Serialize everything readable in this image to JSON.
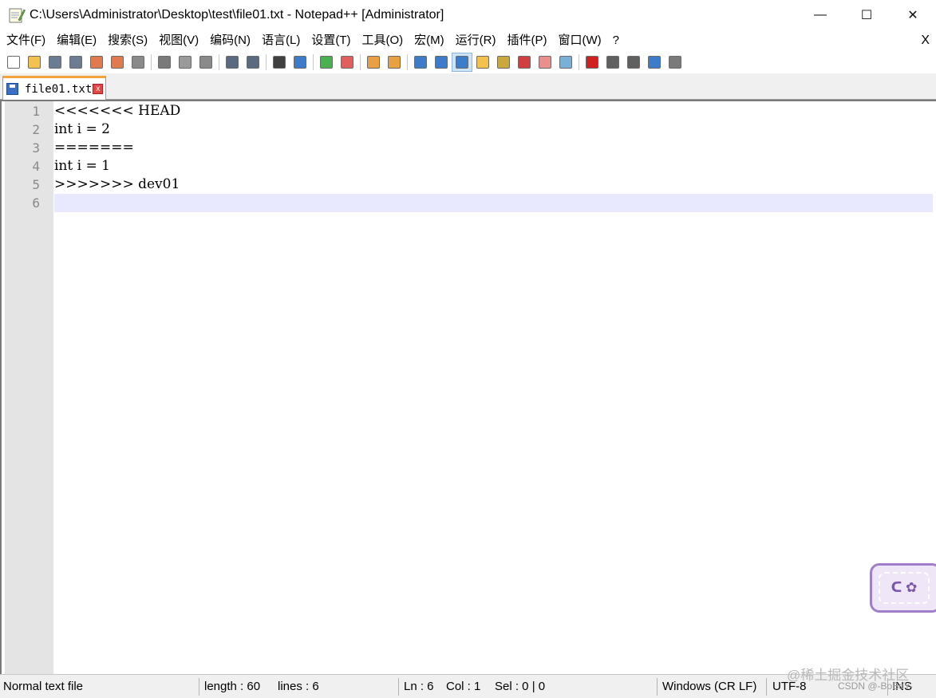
{
  "window": {
    "title": "C:\\Users\\Administrator\\Desktop\\test\\file01.txt - Notepad++ [Administrator]",
    "minimize": "—",
    "maximize": "☐",
    "close": "✕"
  },
  "menu": {
    "items": [
      "文件(F)",
      "编辑(E)",
      "搜索(S)",
      "视图(V)",
      "编码(N)",
      "语言(L)",
      "设置(T)",
      "工具(O)",
      "宏(M)",
      "运行(R)",
      "插件(P)",
      "窗口(W)",
      "?"
    ],
    "close": "X"
  },
  "toolbar": {
    "groups": [
      [
        {
          "name": "new-file-icon",
          "color": "#ffffff"
        },
        {
          "name": "open-file-icon",
          "color": "#f2c14e"
        },
        {
          "name": "save-icon",
          "color": "#6b7c93"
        },
        {
          "name": "save-all-icon",
          "color": "#6b7c93"
        },
        {
          "name": "close-file-icon",
          "color": "#e07a4f"
        },
        {
          "name": "close-all-icon",
          "color": "#e07a4f"
        },
        {
          "name": "print-icon",
          "color": "#8a8a8a"
        }
      ],
      [
        {
          "name": "cut-icon",
          "color": "#7a7a7a"
        },
        {
          "name": "copy-icon",
          "color": "#9a9a9a"
        },
        {
          "name": "paste-icon",
          "color": "#8a8a8a"
        }
      ],
      [
        {
          "name": "undo-icon",
          "color": "#5a6a80"
        },
        {
          "name": "redo-icon",
          "color": "#5a6a80"
        }
      ],
      [
        {
          "name": "find-icon",
          "color": "#404040"
        },
        {
          "name": "replace-icon",
          "color": "#3d7cc9"
        }
      ],
      [
        {
          "name": "zoom-in-icon",
          "color": "#4caf50"
        },
        {
          "name": "zoom-out-icon",
          "color": "#e06060"
        }
      ],
      [
        {
          "name": "sync-vertical-icon",
          "color": "#e8a040"
        },
        {
          "name": "sync-horizontal-icon",
          "color": "#e8a040"
        }
      ],
      [
        {
          "name": "word-wrap-icon",
          "color": "#3d7cc9"
        },
        {
          "name": "show-all-chars-icon",
          "color": "#3d7cc9"
        },
        {
          "name": "indent-guide-icon",
          "color": "#3d7cc9",
          "active": true
        },
        {
          "name": "folder-workspace-icon",
          "color": "#f2c14e"
        },
        {
          "name": "document-map-icon",
          "color": "#c9a83d"
        },
        {
          "name": "function-list-icon",
          "color": "#d04040"
        },
        {
          "name": "folder-as-workspace-icon",
          "color": "#e89090"
        },
        {
          "name": "monitoring-icon",
          "color": "#7ab0d8"
        }
      ],
      [
        {
          "name": "record-macro-icon",
          "color": "#d02020"
        },
        {
          "name": "stop-record-icon",
          "color": "#606060"
        },
        {
          "name": "play-macro-icon",
          "color": "#606060"
        },
        {
          "name": "run-macro-multiple-icon",
          "color": "#3d7cc9"
        },
        {
          "name": "save-macro-icon",
          "color": "#7a7a7a"
        }
      ]
    ]
  },
  "tab": {
    "label": "file01.txt",
    "close": "x"
  },
  "editor": {
    "lines": [
      {
        "number": "1",
        "text": "<<<<<<< HEAD"
      },
      {
        "number": "2",
        "text": "int i = 2"
      },
      {
        "number": "3",
        "text": "======="
      },
      {
        "number": "4",
        "text": "int i = 1"
      },
      {
        "number": "5",
        "text": ">>>>>>> dev01"
      },
      {
        "number": "6",
        "text": ""
      }
    ],
    "caret_line": 6
  },
  "status": {
    "file_type": "Normal text file",
    "length": "length : 60",
    "lines": "lines : 6",
    "ln": "Ln : 6",
    "col": "Col : 1",
    "sel": "Sel : 0 | 0",
    "eol": "Windows (CR LF)",
    "encoding": "UTF-8",
    "mode": "INS"
  },
  "overlay": {
    "watermark_juejin": "@稀土掘金技术社区",
    "watermark_csdn": "CSDN @-BoBoY-",
    "widget_text": "ᑕ ✿"
  }
}
